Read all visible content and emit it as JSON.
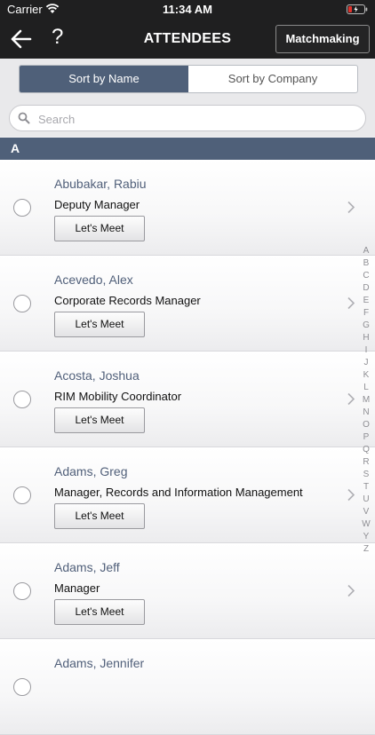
{
  "status_bar": {
    "carrier": "Carrier",
    "time": "11:34 AM"
  },
  "nav": {
    "title": "ATTENDEES",
    "help": "?",
    "matchmaking": "Matchmaking"
  },
  "sort": {
    "by_name": "Sort by Name",
    "by_company": "Sort by Company",
    "selected": "Sort by Name"
  },
  "search": {
    "placeholder": "Search",
    "value": ""
  },
  "section": {
    "letter": "A"
  },
  "attendees": [
    {
      "name": "Abubakar, Rabiu",
      "title": "Deputy Manager",
      "button": "Let's Meet"
    },
    {
      "name": "Acevedo, Alex",
      "title": "Corporate Records Manager",
      "button": "Let's Meet"
    },
    {
      "name": "Acosta, Joshua",
      "title": "RIM Mobility Coordinator",
      "button": "Let's Meet"
    },
    {
      "name": "Adams, Greg",
      "title": "Manager, Records and Information Management",
      "button": "Let's Meet"
    },
    {
      "name": "Adams, Jeff",
      "title": "Manager",
      "button": "Let's Meet"
    },
    {
      "name": "Adams, Jennifer",
      "title": "",
      "button": ""
    }
  ],
  "index_letters": [
    "A",
    "B",
    "C",
    "D",
    "E",
    "F",
    "G",
    "H",
    "I",
    "J",
    "K",
    "L",
    "M",
    "N",
    "O",
    "P",
    "Q",
    "R",
    "S",
    "T",
    "U",
    "V",
    "W",
    "Y",
    "Z"
  ],
  "colors": {
    "accent": "#4f6079",
    "bar": "#1f1f20",
    "battery_low": "#e0312b"
  },
  "icons": {
    "back": "arrow-left-icon",
    "search": "magnifier-icon",
    "chevron": "chevron-right-icon",
    "wifi": "wifi-icon",
    "battery": "battery-icon"
  }
}
